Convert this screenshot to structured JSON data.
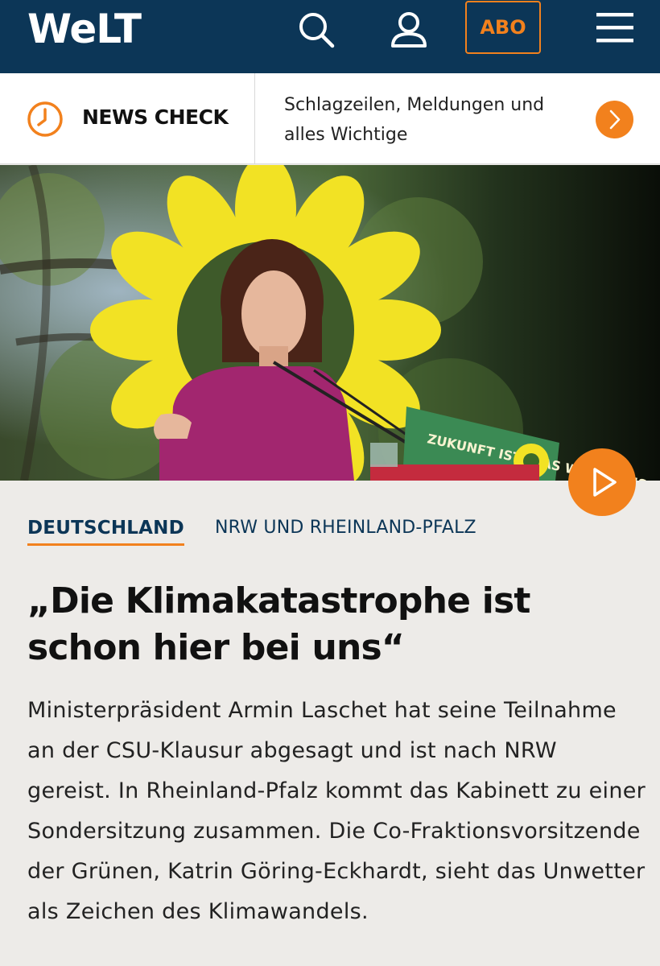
{
  "header": {
    "logo": "WeLT",
    "abo_label": "ABO",
    "icons": [
      "search-icon",
      "account-icon",
      "menu-icon"
    ],
    "colors": {
      "background": "#0c3657",
      "accent": "#f2811d"
    }
  },
  "news_check": {
    "title": "NEWS CHECK",
    "text": "Schlagzeilen, Meldungen und alles Wichtige",
    "icons": [
      "clock-icon",
      "chevron-right-icon"
    ]
  },
  "hero": {
    "banner_text": "ZUKUNFT IST, WAS WIR DRAUS MACHEN",
    "video_icon": "play-icon"
  },
  "article": {
    "category": "DEUTSCHLAND",
    "subcategory": "NRW UND RHEINLAND-PFALZ",
    "headline": "„Die Klimakatastrophe ist schon hier bei uns“",
    "teaser": "Ministerpräsident Armin Laschet hat seine Teilnahme an der CSU-Klausur abgesagt und ist nach NRW gereist. In Rheinland-Pfalz kommt das Kabinett zu einer Sondersitzung zusammen. Die Co-Fraktionsvorsitzende der Grünen, Katrin Göring-Eckhardt, sieht das Unwetter als Zeichen des Klimawandels."
  }
}
